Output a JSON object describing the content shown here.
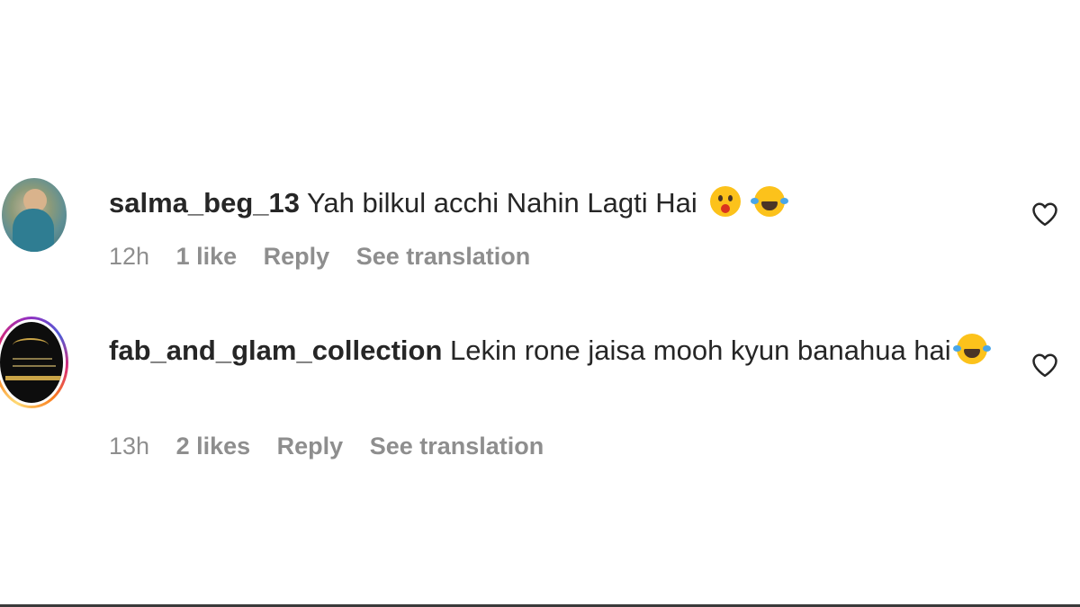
{
  "comments": [
    {
      "username": "salma_beg_13",
      "text": "Yah bilkul acchi Nahin Lagti Hai",
      "emojis": [
        "astonished-face-emoji",
        "face-with-tears-of-joy-emoji"
      ],
      "time": "12h",
      "likes": "1 like",
      "reply_label": "Reply",
      "translate_label": "See translation"
    },
    {
      "username": "fab_and_glam_collection",
      "text": "Lekin rone jaisa mooh kyun banahua hai",
      "emojis": [
        "face-with-tears-of-joy-emoji"
      ],
      "time": "13h",
      "likes": "2 likes",
      "reply_label": "Reply",
      "translate_label": "See translation"
    }
  ],
  "colors": {
    "text": "#262626",
    "meta": "#8e8e8e",
    "story_ring": [
      "#feda75",
      "#fa7e1e",
      "#d62976",
      "#962fbf",
      "#4f5bd5"
    ]
  }
}
